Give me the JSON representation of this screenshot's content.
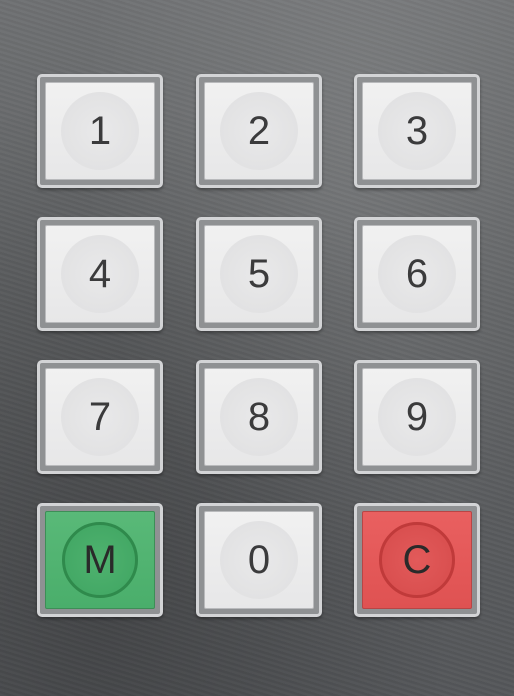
{
  "keypad": {
    "keys": [
      {
        "label": "1"
      },
      {
        "label": "2"
      },
      {
        "label": "3"
      },
      {
        "label": "4"
      },
      {
        "label": "5"
      },
      {
        "label": "6"
      },
      {
        "label": "7"
      },
      {
        "label": "8"
      },
      {
        "label": "9"
      },
      {
        "label": "M",
        "color": "#52b573"
      },
      {
        "label": "0"
      },
      {
        "label": "C",
        "color": "#e45858"
      }
    ]
  },
  "colors": {
    "panel": "#5f6163",
    "key_face": "#ececed",
    "key_border": "#d3d4d6",
    "memory_key": "#52b573",
    "clear_key": "#e45858"
  }
}
